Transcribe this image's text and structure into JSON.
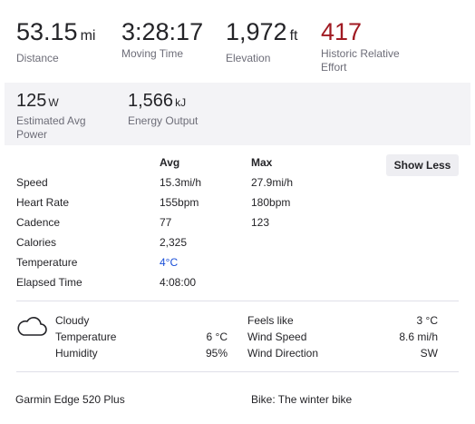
{
  "top_stats": [
    {
      "value": "53.15",
      "unit": "mi",
      "label": "Distance"
    },
    {
      "value": "3:28:17",
      "unit": "",
      "label": "Moving Time"
    },
    {
      "value": "1,972",
      "unit": "ft",
      "label": "Elevation"
    },
    {
      "value": "417",
      "unit": "",
      "label_line1": "Historic Relative",
      "label_line2": "Effort",
      "color": "#a01a22"
    }
  ],
  "power_stats": [
    {
      "value": "125",
      "unit": "W",
      "label_line1": "Estimated Avg",
      "label_line2": "Power"
    },
    {
      "value": "1,566",
      "unit": "kJ",
      "label": "Energy Output"
    }
  ],
  "table": {
    "headers": {
      "avg": "Avg",
      "max": "Max"
    },
    "show_less_label": "Show Less",
    "rows": [
      {
        "label": "Speed",
        "avg": "15.3mi/h",
        "max": "27.9mi/h"
      },
      {
        "label": "Heart Rate",
        "avg": "155bpm",
        "max": "180bpm"
      },
      {
        "label": "Cadence",
        "avg": "77",
        "max": "123"
      },
      {
        "label": "Calories",
        "avg": "2,325",
        "max": ""
      },
      {
        "label": "Temperature",
        "avg": "4°C",
        "max": ""
      },
      {
        "label": "Elapsed Time",
        "avg": "4:08:00",
        "max": ""
      }
    ]
  },
  "weather": {
    "icon": "cloud-icon",
    "condition": "Cloudy",
    "temperature_label": "Temperature",
    "temperature_value": "6 °C",
    "humidity_label": "Humidity",
    "humidity_value": "95%",
    "feels_like_label": "Feels like",
    "feels_like_value": "3 °C",
    "wind_speed_label": "Wind Speed",
    "wind_speed_value": "8.6 mi/h",
    "wind_direction_label": "Wind Direction",
    "wind_direction_value": "SW"
  },
  "footer": {
    "device": "Garmin Edge 520 Plus",
    "bike": "Bike: The winter bike"
  },
  "colors": {
    "relative_effort": "#a01a22",
    "temperature_link": "#1a4fd8",
    "power_band_bg": "#f3f3f6"
  }
}
